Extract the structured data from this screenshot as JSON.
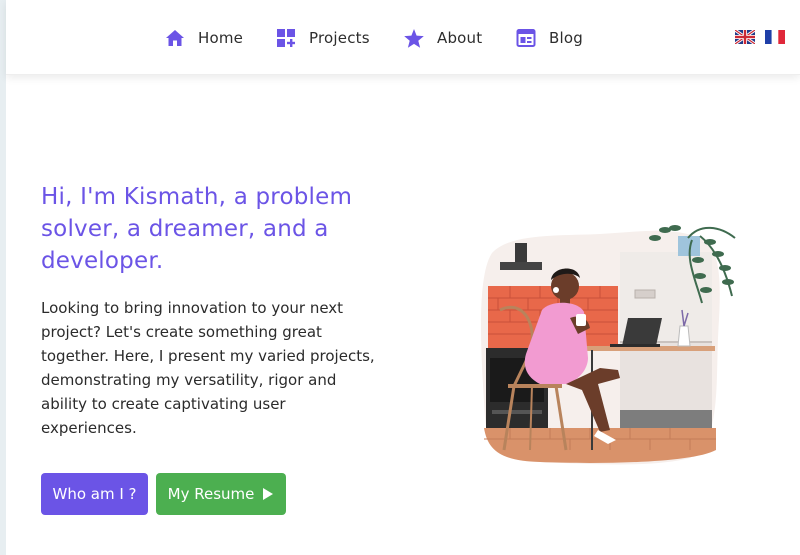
{
  "nav": {
    "items": [
      {
        "label": "Home",
        "icon": "home-icon"
      },
      {
        "label": "Projects",
        "icon": "projects-icon"
      },
      {
        "label": "About",
        "icon": "star-icon"
      },
      {
        "label": "Blog",
        "icon": "blog-icon"
      }
    ],
    "languages": [
      {
        "icon": "uk-flag-icon"
      },
      {
        "icon": "fr-flag-icon"
      }
    ]
  },
  "hero": {
    "title": "Hi, I'm Kismath, a problem solver, a dreamer, and a developer.",
    "text": "Looking to bring innovation to your next project? Let's create something great together. Here, I present my varied projects, demonstrating my versatility, rigor and ability to create captivating user experiences.",
    "buttons": {
      "primary_label": "Who am I ?",
      "resume_label": "My Resume"
    }
  },
  "colors": {
    "accent": "#6b54e6",
    "resume_button": "#4caf50",
    "nav_text": "#2d2d2d"
  }
}
